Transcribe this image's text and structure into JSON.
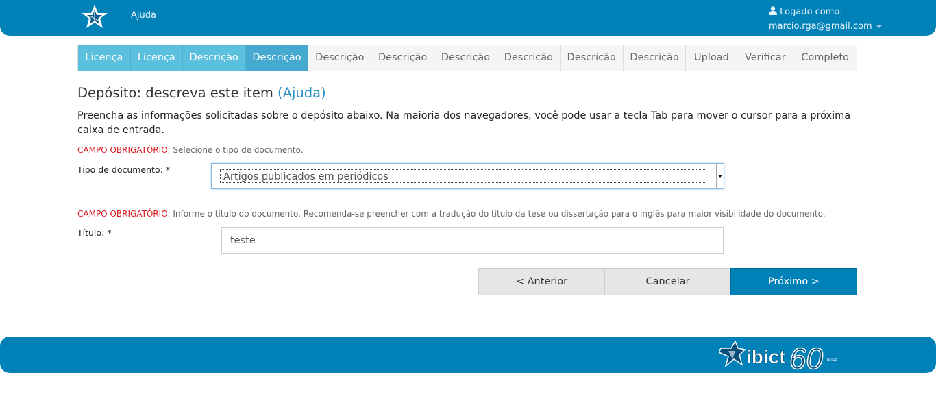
{
  "header": {
    "help_label": "Ajuda",
    "logged_as_label": "Logado como:",
    "user_email": "marcio.rga@gmail.com"
  },
  "steps": [
    {
      "label": "Licença",
      "state": "done"
    },
    {
      "label": "Licença",
      "state": "done"
    },
    {
      "label": "Descrição",
      "state": "done"
    },
    {
      "label": "Descrição",
      "state": "current"
    },
    {
      "label": "Descrição",
      "state": "todo"
    },
    {
      "label": "Descrição",
      "state": "todo"
    },
    {
      "label": "Descrição",
      "state": "todo"
    },
    {
      "label": "Descrição",
      "state": "todo"
    },
    {
      "label": "Descrição",
      "state": "todo"
    },
    {
      "label": "Descrição",
      "state": "todo"
    },
    {
      "label": "Upload",
      "state": "todo"
    },
    {
      "label": "Verificar",
      "state": "todo"
    },
    {
      "label": "Completo",
      "state": "todo"
    }
  ],
  "page": {
    "title": "Depósito: descreva este item",
    "help_link": "(Ajuda)",
    "intro": "Preencha as informações solicitadas sobre o depósito abaixo. Na maioria dos navegadores, você pode usar a tecla Tab para mover o cursor para a próxima caixa de entrada."
  },
  "fields": {
    "doc_type": {
      "required_tag": "CAMPO OBRIGATÓRIO:",
      "hint": "Selecione o tipo de documento.",
      "label": "Tipo de documento: *",
      "selected": "Artigos publicados em periódicos"
    },
    "title": {
      "required_tag": "CAMPO OBRIGATÓRIO:",
      "hint": "Informe o título do documento. Recomenda-se preencher com a tradução do título da tese ou dissertação para o inglês para maior visibilidade do documento.",
      "label": "Título: *",
      "value": "teste"
    }
  },
  "buttons": {
    "previous": "< Anterior",
    "cancel": "Cancelar",
    "next": "Próximo >"
  },
  "footer": {
    "logo_text": "ibict",
    "logo_anniversary": "60",
    "logo_anos": "anos"
  },
  "colors": {
    "brand_blue": "#0082b8",
    "step_done": "#5bc0de",
    "required_red": "#d9181f"
  }
}
